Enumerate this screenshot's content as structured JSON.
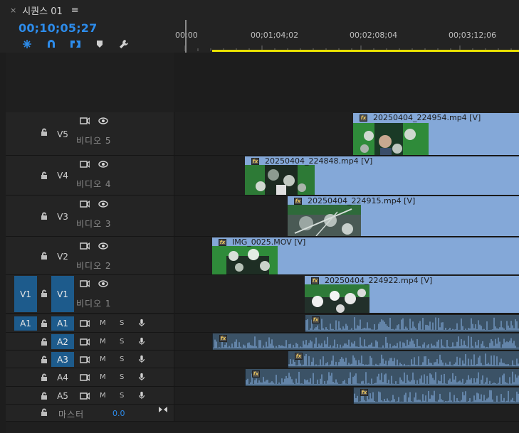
{
  "tab": {
    "close_label": "×",
    "title": "시퀀스 01",
    "menu_label": "≡"
  },
  "header": {
    "timecode": "00;10;05;27",
    "tools": [
      "snap-insert-icon",
      "magnet-icon",
      "linked-selection-icon",
      "marker-icon",
      "wrench-icon"
    ],
    "ruler_labels": [
      "00;00",
      "00;01;04;02",
      "00;02;08;04",
      "00;03;12;06"
    ]
  },
  "video_tracks": [
    {
      "id": "V5",
      "label": "비디오 5",
      "source_patch": "",
      "clip": {
        "name": "20250404_224954.mp4 [V]",
        "thumb": "drums-person"
      }
    },
    {
      "id": "V4",
      "label": "비디오 4",
      "source_patch": "",
      "clip": {
        "name": "20250404_224848.mp4 [V]",
        "thumb": "drums-dark"
      }
    },
    {
      "id": "V3",
      "label": "비디오 3",
      "source_patch": "",
      "clip": {
        "name": "20250404_224915.mp4 [V]",
        "thumb": "drums-top"
      }
    },
    {
      "id": "V2",
      "label": "비디오 2",
      "source_patch": "",
      "clip": {
        "name": "IMG_0025.MOV [V]",
        "thumb": "drums-green"
      }
    },
    {
      "id": "V1",
      "label": "비디오 1",
      "source_patch": "V1",
      "clip": {
        "name": "20250404_224922.mp4 [V]",
        "thumb": "drums-white"
      }
    }
  ],
  "audio_tracks": [
    {
      "id": "A1",
      "source_patch": "A1",
      "mute": "M",
      "solo": "S"
    },
    {
      "id": "A2",
      "source_patch": "",
      "mute": "M",
      "solo": "S"
    },
    {
      "id": "A3",
      "source_patch": "",
      "mute": "M",
      "solo": "S"
    },
    {
      "id": "A4",
      "source_patch": "",
      "mute": "M",
      "solo": "S"
    },
    {
      "id": "A5",
      "source_patch": "",
      "mute": "M",
      "solo": "S"
    }
  ],
  "master": {
    "label": "마스터",
    "value": "0.0"
  },
  "colors": {
    "accent": "#2d8ceb",
    "video_clip": "#84a8d8",
    "audio_clip": "#3b5266",
    "patch": "#1d5b8c",
    "work_area": "#e8e000"
  }
}
